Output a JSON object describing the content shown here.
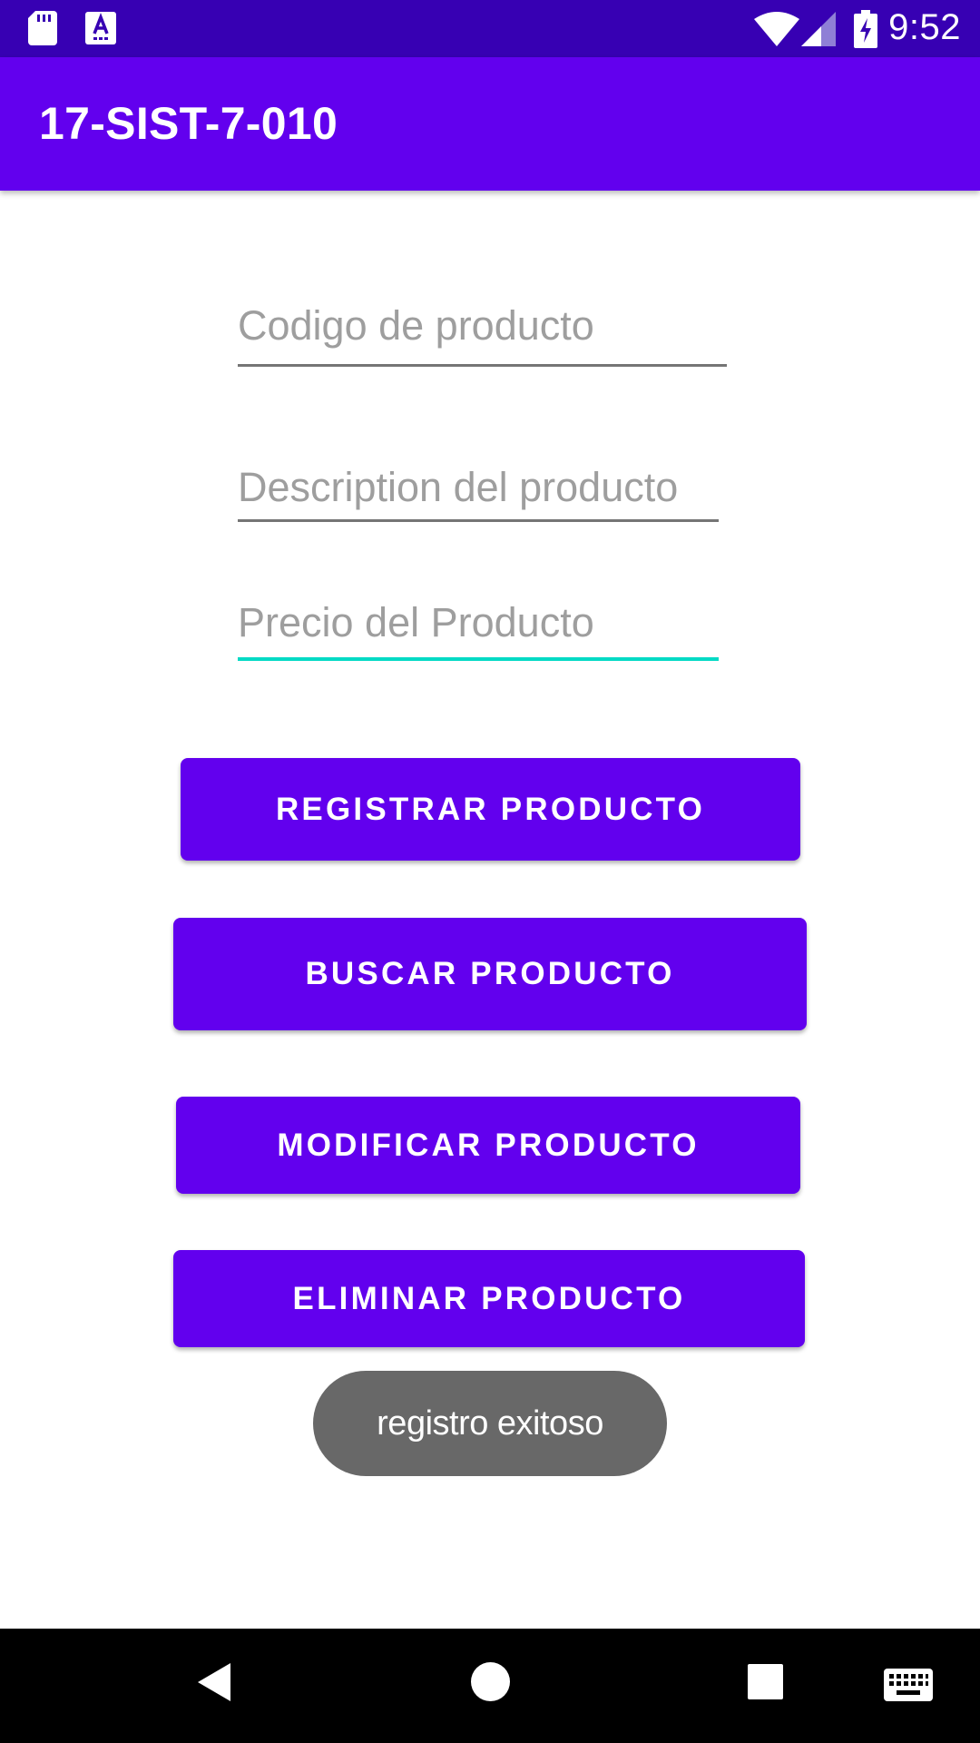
{
  "status_bar": {
    "time": "9:52",
    "icons": [
      "sd-card-icon",
      "keyboard-assist-icon",
      "wifi-icon",
      "signal-icon",
      "battery-charging-icon"
    ],
    "background_color": "#3700B3"
  },
  "app_bar": {
    "title": "17-SIST-7-010",
    "background_color": "#6200EE"
  },
  "form": {
    "codigo": {
      "placeholder": "Codigo de producto",
      "value": ""
    },
    "descripcion": {
      "placeholder": "Description del producto",
      "value": ""
    },
    "precio": {
      "placeholder": "Precio del Producto",
      "value": "",
      "focused": true
    },
    "focus_color": "#03DAC5"
  },
  "buttons": {
    "registrar": "REGISTRAR PRODUCTO",
    "buscar": "BUSCAR PRODUCTO",
    "modificar": "MODIFICAR PRODUCTO",
    "eliminar": "ELIMINAR PRODUCTO",
    "color": "#6200EE"
  },
  "toast": {
    "message": "registro exitoso"
  },
  "nav_bar": {
    "icons": [
      "back-icon",
      "home-icon",
      "recents-icon",
      "keyboard-icon"
    ]
  }
}
